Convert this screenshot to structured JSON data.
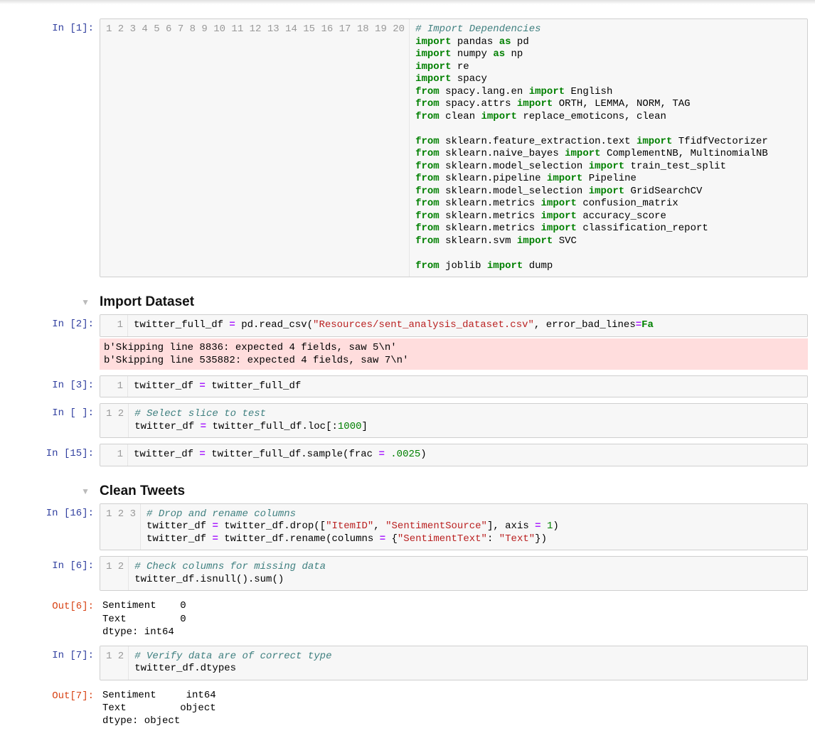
{
  "headings": {
    "import": "Import Dataset",
    "clean": "Clean Tweets",
    "toggle_glyph": "▼"
  },
  "prompts": {
    "in1": "In [1]:",
    "in2": "In [2]:",
    "in3": "In [3]:",
    "in_blank": "In [ ]:",
    "in15": "In [15]:",
    "in16": "In [16]:",
    "in6": "In [6]:",
    "out6": "Out[6]:",
    "in7": "In [7]:",
    "out7": "Out[7]:"
  },
  "cell1": {
    "gutter": "1\n2\n3\n4\n5\n6\n7\n8\n9\n10\n11\n12\n13\n14\n15\n16\n17\n18\n19\n20",
    "lines": [
      [
        {
          "cls": "c",
          "t": "# Import Dependencies"
        }
      ],
      [
        {
          "cls": "k",
          "t": "import"
        },
        {
          "t": " pandas "
        },
        {
          "cls": "k",
          "t": "as"
        },
        {
          "t": " pd"
        }
      ],
      [
        {
          "cls": "k",
          "t": "import"
        },
        {
          "t": " numpy "
        },
        {
          "cls": "k",
          "t": "as"
        },
        {
          "t": " np"
        }
      ],
      [
        {
          "cls": "k",
          "t": "import"
        },
        {
          "t": " re"
        }
      ],
      [
        {
          "cls": "k",
          "t": "import"
        },
        {
          "t": " spacy"
        }
      ],
      [
        {
          "cls": "k",
          "t": "from"
        },
        {
          "t": " spacy.lang.en "
        },
        {
          "cls": "k",
          "t": "import"
        },
        {
          "t": " English"
        }
      ],
      [
        {
          "cls": "k",
          "t": "from"
        },
        {
          "t": " spacy.attrs "
        },
        {
          "cls": "k",
          "t": "import"
        },
        {
          "t": " ORTH, LEMMA, NORM, TAG"
        }
      ],
      [
        {
          "cls": "k",
          "t": "from"
        },
        {
          "t": " clean "
        },
        {
          "cls": "k",
          "t": "import"
        },
        {
          "t": " replace_emoticons, clean"
        }
      ],
      [
        {
          "t": ""
        }
      ],
      [
        {
          "cls": "k",
          "t": "from"
        },
        {
          "t": " sklearn.feature_extraction.text "
        },
        {
          "cls": "k",
          "t": "import"
        },
        {
          "t": " TfidfVectorizer"
        }
      ],
      [
        {
          "cls": "k",
          "t": "from"
        },
        {
          "t": " sklearn.naive_bayes "
        },
        {
          "cls": "k",
          "t": "import"
        },
        {
          "t": " ComplementNB, MultinomialNB"
        }
      ],
      [
        {
          "cls": "k",
          "t": "from"
        },
        {
          "t": " sklearn.model_selection "
        },
        {
          "cls": "k",
          "t": "import"
        },
        {
          "t": " train_test_split"
        }
      ],
      [
        {
          "cls": "k",
          "t": "from"
        },
        {
          "t": " sklearn.pipeline "
        },
        {
          "cls": "k",
          "t": "import"
        },
        {
          "t": " Pipeline"
        }
      ],
      [
        {
          "cls": "k",
          "t": "from"
        },
        {
          "t": " sklearn.model_selection "
        },
        {
          "cls": "k",
          "t": "import"
        },
        {
          "t": " GridSearchCV"
        }
      ],
      [
        {
          "cls": "k",
          "t": "from"
        },
        {
          "t": " sklearn.metrics "
        },
        {
          "cls": "k",
          "t": "import"
        },
        {
          "t": " confusion_matrix"
        }
      ],
      [
        {
          "cls": "k",
          "t": "from"
        },
        {
          "t": " sklearn.metrics "
        },
        {
          "cls": "k",
          "t": "import"
        },
        {
          "t": " accuracy_score"
        }
      ],
      [
        {
          "cls": "k",
          "t": "from"
        },
        {
          "t": " sklearn.metrics "
        },
        {
          "cls": "k",
          "t": "import"
        },
        {
          "t": " classification_report"
        }
      ],
      [
        {
          "cls": "k",
          "t": "from"
        },
        {
          "t": " sklearn.svm "
        },
        {
          "cls": "k",
          "t": "import"
        },
        {
          "t": " SVC"
        }
      ],
      [
        {
          "t": ""
        }
      ],
      [
        {
          "cls": "k",
          "t": "from"
        },
        {
          "t": " joblib "
        },
        {
          "cls": "k",
          "t": "import"
        },
        {
          "t": " dump"
        }
      ]
    ]
  },
  "cell2": {
    "gutter": "1",
    "lines": [
      [
        {
          "t": "twitter_full_df "
        },
        {
          "cls": "op",
          "t": "="
        },
        {
          "t": " pd.read_csv("
        },
        {
          "cls": "s",
          "t": "\"Resources/sent_analysis_dataset.csv\""
        },
        {
          "t": ", error_bad_lines"
        },
        {
          "cls": "op",
          "t": "="
        },
        {
          "cls": "kc",
          "t": "Fa"
        }
      ]
    ],
    "stderr": "b'Skipping line 8836: expected 4 fields, saw 5\\n'\nb'Skipping line 535882: expected 4 fields, saw 7\\n'"
  },
  "cell3": {
    "gutter": "1",
    "lines": [
      [
        {
          "t": "twitter_df "
        },
        {
          "cls": "op",
          "t": "="
        },
        {
          "t": " twitter_full_df"
        }
      ]
    ]
  },
  "cell_blank": {
    "gutter": "1\n2",
    "lines": [
      [
        {
          "cls": "c",
          "t": "# Select slice to test"
        }
      ],
      [
        {
          "t": "twitter_df "
        },
        {
          "cls": "op",
          "t": "="
        },
        {
          "t": " twitter_full_df.loc[:"
        },
        {
          "cls": "mi",
          "t": "1000"
        },
        {
          "t": "]"
        }
      ]
    ]
  },
  "cell15": {
    "gutter": "1",
    "lines": [
      [
        {
          "t": "twitter_df "
        },
        {
          "cls": "op",
          "t": "="
        },
        {
          "t": " twitter_full_df.sample(frac "
        },
        {
          "cls": "op",
          "t": "="
        },
        {
          "t": " "
        },
        {
          "cls": "mi",
          "t": ".0025"
        },
        {
          "t": ")"
        }
      ]
    ]
  },
  "cell16": {
    "gutter": "1\n2\n3",
    "lines": [
      [
        {
          "cls": "c",
          "t": "# Drop and rename columns"
        }
      ],
      [
        {
          "t": "twitter_df "
        },
        {
          "cls": "op",
          "t": "="
        },
        {
          "t": " twitter_df.drop(["
        },
        {
          "cls": "s",
          "t": "\"ItemID\""
        },
        {
          "t": ", "
        },
        {
          "cls": "s",
          "t": "\"SentimentSource\""
        },
        {
          "t": "], axis "
        },
        {
          "cls": "op",
          "t": "="
        },
        {
          "t": " "
        },
        {
          "cls": "mi",
          "t": "1"
        },
        {
          "t": ")"
        }
      ],
      [
        {
          "t": "twitter_df "
        },
        {
          "cls": "op",
          "t": "="
        },
        {
          "t": " twitter_df.rename(columns "
        },
        {
          "cls": "op",
          "t": "="
        },
        {
          "t": " {"
        },
        {
          "cls": "s",
          "t": "\"SentimentText\""
        },
        {
          "t": ": "
        },
        {
          "cls": "s",
          "t": "\"Text\""
        },
        {
          "t": "})"
        }
      ]
    ]
  },
  "cell6": {
    "gutter": "1\n2",
    "lines": [
      [
        {
          "cls": "c",
          "t": "# Check columns for missing data"
        }
      ],
      [
        {
          "t": "twitter_df.isnull().sum()"
        }
      ]
    ],
    "output": "Sentiment    0\nText         0\ndtype: int64"
  },
  "cell7": {
    "gutter": "1\n2",
    "lines": [
      [
        {
          "cls": "c",
          "t": "# Verify data are of correct type"
        }
      ],
      [
        {
          "t": "twitter_df.dtypes"
        }
      ]
    ],
    "output": "Sentiment     int64\nText         object\ndtype: object"
  }
}
